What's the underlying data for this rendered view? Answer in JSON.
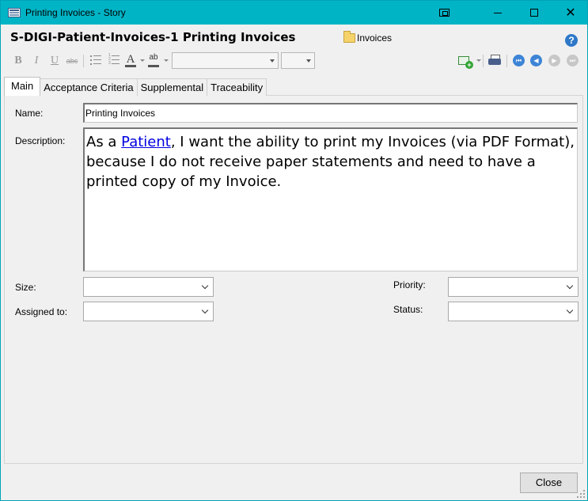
{
  "window": {
    "title": "Printing Invoices - Story",
    "close_glyph": "✕"
  },
  "header": {
    "story_title": "S-DIGI-Patient-Invoices-1 Printing Invoices",
    "folder_name": "Invoices",
    "help_glyph": "?"
  },
  "toolbar": {
    "bold": "B",
    "italic": "I",
    "underline": "U",
    "strikethrough": "abc",
    "numbered_list_marks": "1\n2\n3",
    "font_color": "A",
    "highlight": "ab",
    "font_name": "",
    "font_size": "",
    "nav_first": "⏮",
    "nav_prev": "◀",
    "nav_next": "▶",
    "nav_last": "⏭"
  },
  "tabs": [
    {
      "label": "Main",
      "active": true
    },
    {
      "label": "Acceptance Criteria",
      "active": false
    },
    {
      "label": "Supplemental",
      "active": false
    },
    {
      "label": "Traceability",
      "active": false
    }
  ],
  "form": {
    "name_label": "Name:",
    "name_value": "Printing Invoices",
    "description_label": "Description:",
    "description": {
      "prefix": "As a ",
      "link": "Patient",
      "suffix": ", I want the ability to print my Invoices (via PDF Format), because I do not receive paper statements and need to have a printed copy of my Invoice."
    },
    "size_label": "Size:",
    "size_value": "",
    "assigned_label": "Assigned to:",
    "assigned_value": "",
    "priority_label": "Priority:",
    "priority_value": "",
    "status_label": "Status:",
    "status_value": ""
  },
  "footer": {
    "close_label": "Close"
  },
  "colors": {
    "titlebar": "#00b4c6",
    "link": "#0000e0",
    "window_bg": "#f0f0f0"
  }
}
